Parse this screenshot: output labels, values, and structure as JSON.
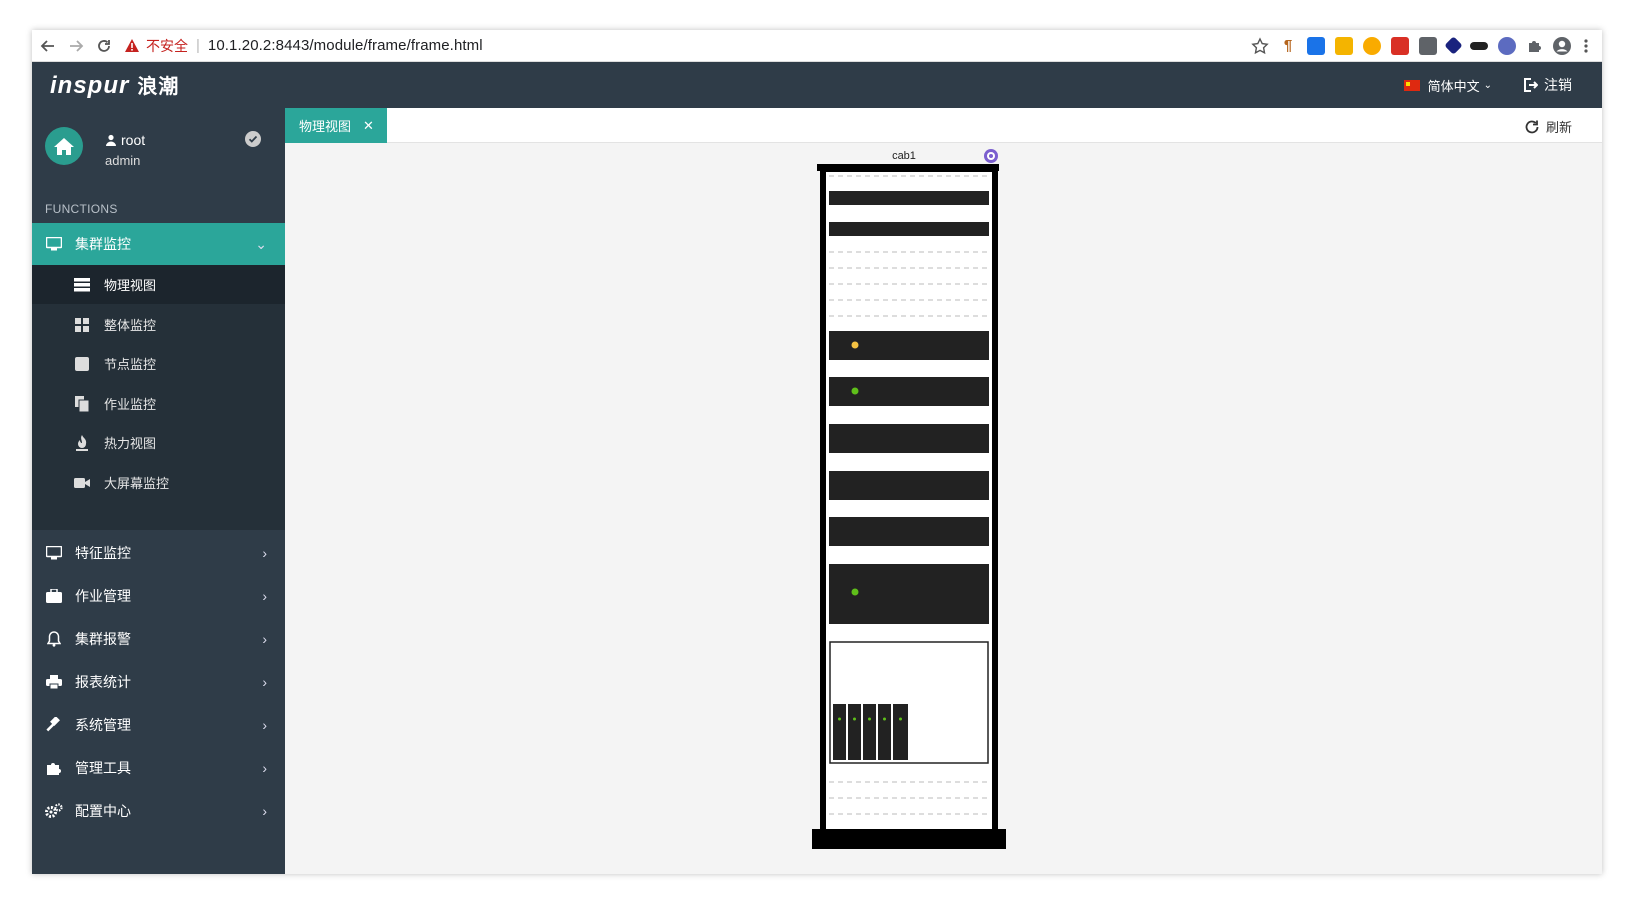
{
  "browser": {
    "insecure_label": "不安全",
    "url": "10.1.20.2:8443/module/frame/frame.html"
  },
  "header": {
    "logo_text": "inspur",
    "logo_cn": "浪潮",
    "language": "简体中文",
    "logout": "注销"
  },
  "user": {
    "name": "root",
    "role": "admin"
  },
  "sidebar": {
    "section_label": "FUNCTIONS",
    "active_group": "集群监控",
    "sub_items": [
      {
        "label": "物理视图",
        "icon": "server-icon",
        "active": true
      },
      {
        "label": "整体监控",
        "icon": "grid-icon",
        "active": false
      },
      {
        "label": "节点监控",
        "icon": "square-icon",
        "active": false
      },
      {
        "label": "作业监控",
        "icon": "documents-icon",
        "active": false
      },
      {
        "label": "热力视图",
        "icon": "fire-icon",
        "active": false
      },
      {
        "label": "大屏幕监控",
        "icon": "video-camera-icon",
        "active": false
      }
    ],
    "groups": [
      {
        "label": "特征监控",
        "icon": "monitor-icon"
      },
      {
        "label": "作业管理",
        "icon": "briefcase-icon"
      },
      {
        "label": "集群报警",
        "icon": "bell-icon"
      },
      {
        "label": "报表统计",
        "icon": "printer-icon"
      },
      {
        "label": "系统管理",
        "icon": "gavel-icon"
      },
      {
        "label": "管理工具",
        "icon": "puzzle-icon"
      },
      {
        "label": "配置中心",
        "icon": "gears-icon"
      }
    ]
  },
  "tabs": [
    {
      "label": "物理视图",
      "active": true
    }
  ],
  "toolbar": {
    "refresh": "刷新"
  },
  "rack": {
    "name": "cab1",
    "status_colors": {
      "warning": "#f5c242",
      "ok": "#5fbf1a"
    }
  },
  "colors": {
    "sidebar_bg": "#2f3c48",
    "accent": "#2ba69a"
  }
}
